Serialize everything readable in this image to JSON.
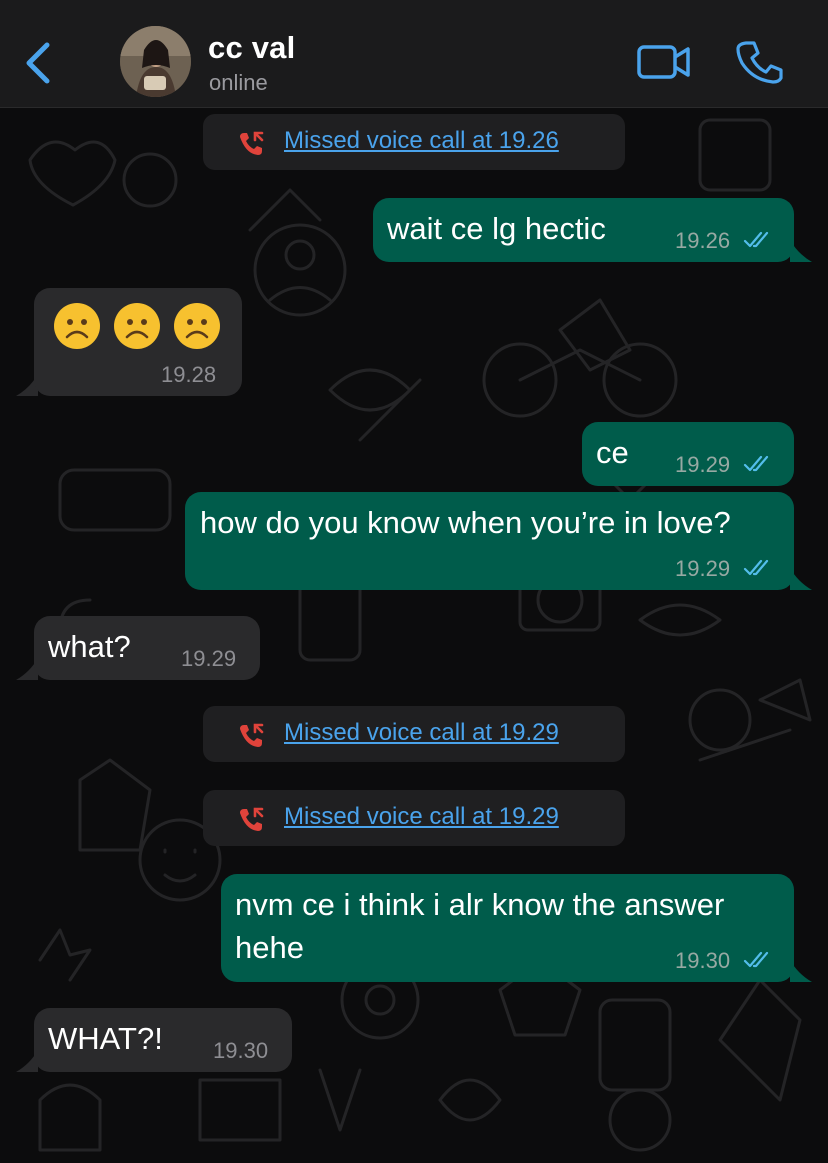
{
  "header": {
    "back_icon": "chevron-left-icon",
    "contact_name": "cc val",
    "status": "online",
    "video_icon": "video-camera-icon",
    "call_icon": "phone-icon"
  },
  "colors": {
    "header_bg": "#1b1b1c",
    "outgoing_bubble": "#005c4b",
    "incoming_bubble": "#2a2a2c",
    "accent": "#4aa3ec",
    "missed_call_red": "#e0433b",
    "read_ticks": "#53bdeb"
  },
  "messages": {
    "m1": {
      "text": "Missed voice call at 19.26"
    },
    "m2": {
      "text": "wait ce lg hectic",
      "time": "19.26"
    },
    "m3": {
      "emoji": "☹️☹️☹️",
      "time": "19.28"
    },
    "m4": {
      "text": "ce",
      "time": "19.29"
    },
    "m5": {
      "text": "how do you know when you’re in love?",
      "time": "19.29"
    },
    "m6": {
      "text": "what?",
      "time": "19.29"
    },
    "m7": {
      "text": "Missed voice call at 19.29"
    },
    "m8": {
      "text": "Missed voice call at 19.29"
    },
    "m9": {
      "line1": "nvm ce i think i alr know the answer",
      "line2": "hehe",
      "time": "19.30"
    },
    "m10": {
      "text": "WHAT?!",
      "time": "19.30"
    }
  }
}
